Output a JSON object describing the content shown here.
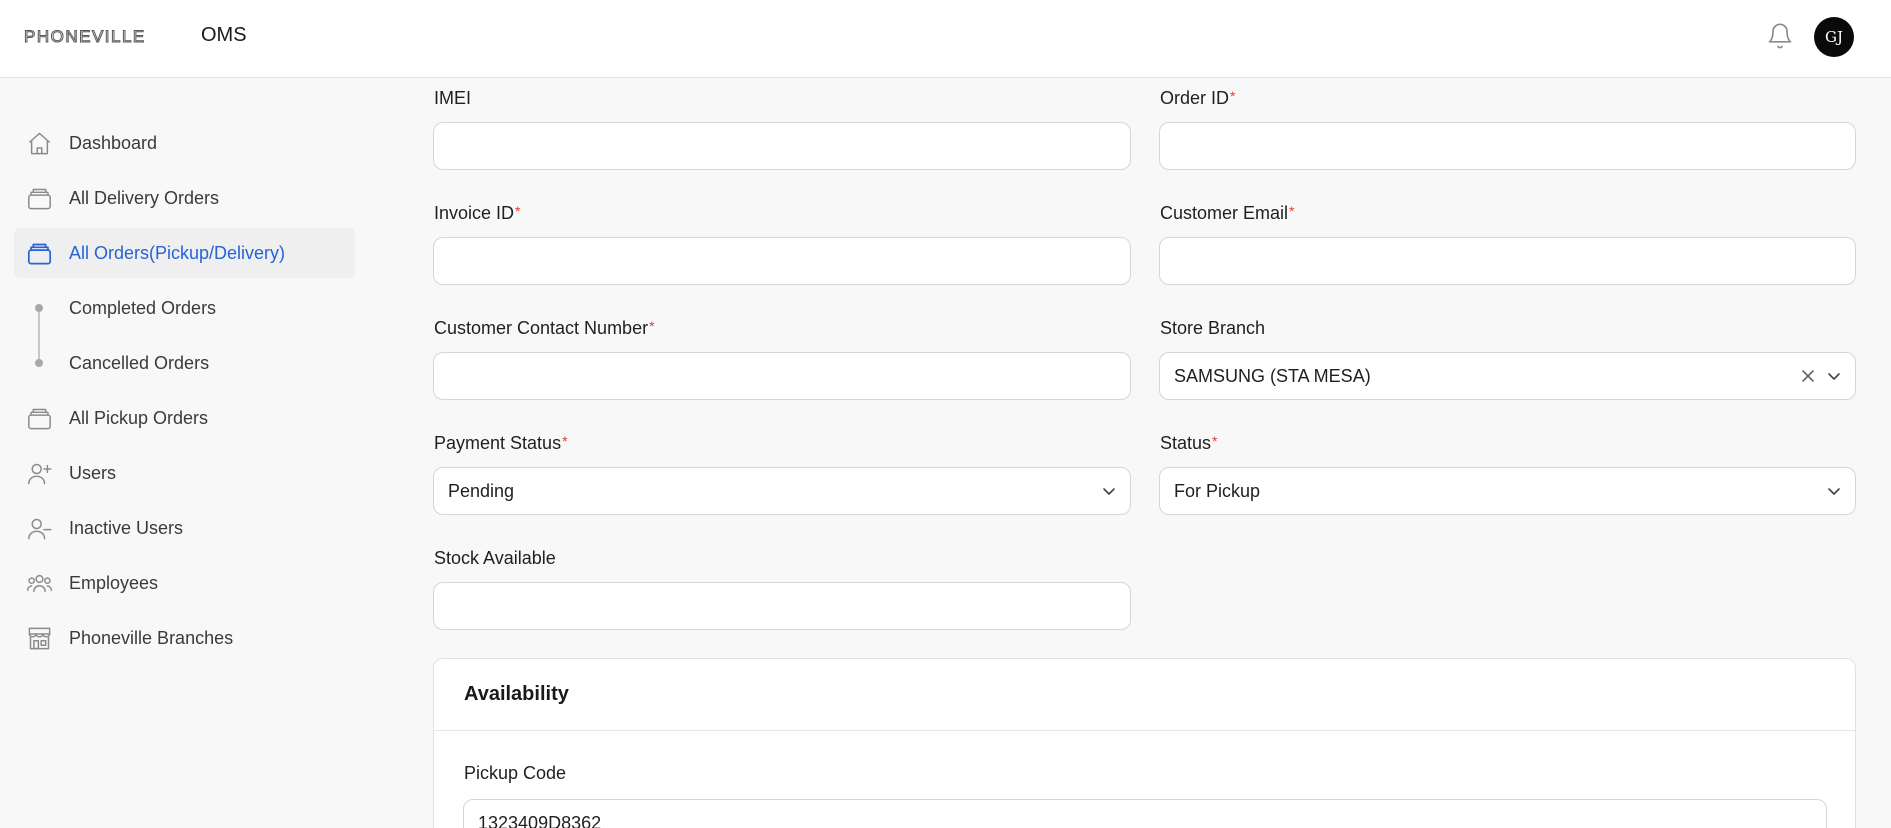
{
  "header": {
    "logo_text": "PHONEVILLE",
    "app_title": "OMS",
    "avatar_initials": "GJ"
  },
  "sidebar": {
    "items": [
      {
        "label": "Dashboard",
        "icon": "home-icon"
      },
      {
        "label": "All Delivery Orders",
        "icon": "box-stack-icon"
      },
      {
        "label": "All Orders(Pickup/Delivery)",
        "icon": "box-stack-icon",
        "active": true
      },
      {
        "label": "Completed Orders",
        "icon": "dot-icon"
      },
      {
        "label": "Cancelled Orders",
        "icon": "dot-icon"
      },
      {
        "label": "All Pickup Orders",
        "icon": "box-stack-icon"
      },
      {
        "label": "Users",
        "icon": "user-plus-icon"
      },
      {
        "label": "Inactive Users",
        "icon": "user-minus-icon"
      },
      {
        "label": "Employees",
        "icon": "users-group-icon"
      },
      {
        "label": "Phoneville Branches",
        "icon": "storefront-icon"
      }
    ]
  },
  "form": {
    "imei": {
      "label": "IMEI",
      "value": ""
    },
    "order_id": {
      "label": "Order ID",
      "required": "*",
      "value": ""
    },
    "invoice_id": {
      "label": "Invoice ID",
      "required": "*",
      "value": ""
    },
    "customer_email": {
      "label": "Customer Email",
      "required": "*",
      "value": ""
    },
    "customer_contact": {
      "label": "Customer Contact Number",
      "required": "*",
      "value": ""
    },
    "store_branch": {
      "label": "Store Branch",
      "value": "SAMSUNG (STA MESA)"
    },
    "payment_status": {
      "label": "Payment Status",
      "required": "*",
      "value": "Pending"
    },
    "status": {
      "label": "Status",
      "required": "*",
      "value": "For Pickup"
    },
    "stock_available": {
      "label": "Stock Available",
      "value": ""
    }
  },
  "availability": {
    "title": "Availability",
    "pickup_code_label": "Pickup Code",
    "pickup_code_value": "1323409D8362"
  },
  "colors": {
    "accent": "#2563d6",
    "required": "#e53935",
    "background": "#f8f8f8"
  }
}
